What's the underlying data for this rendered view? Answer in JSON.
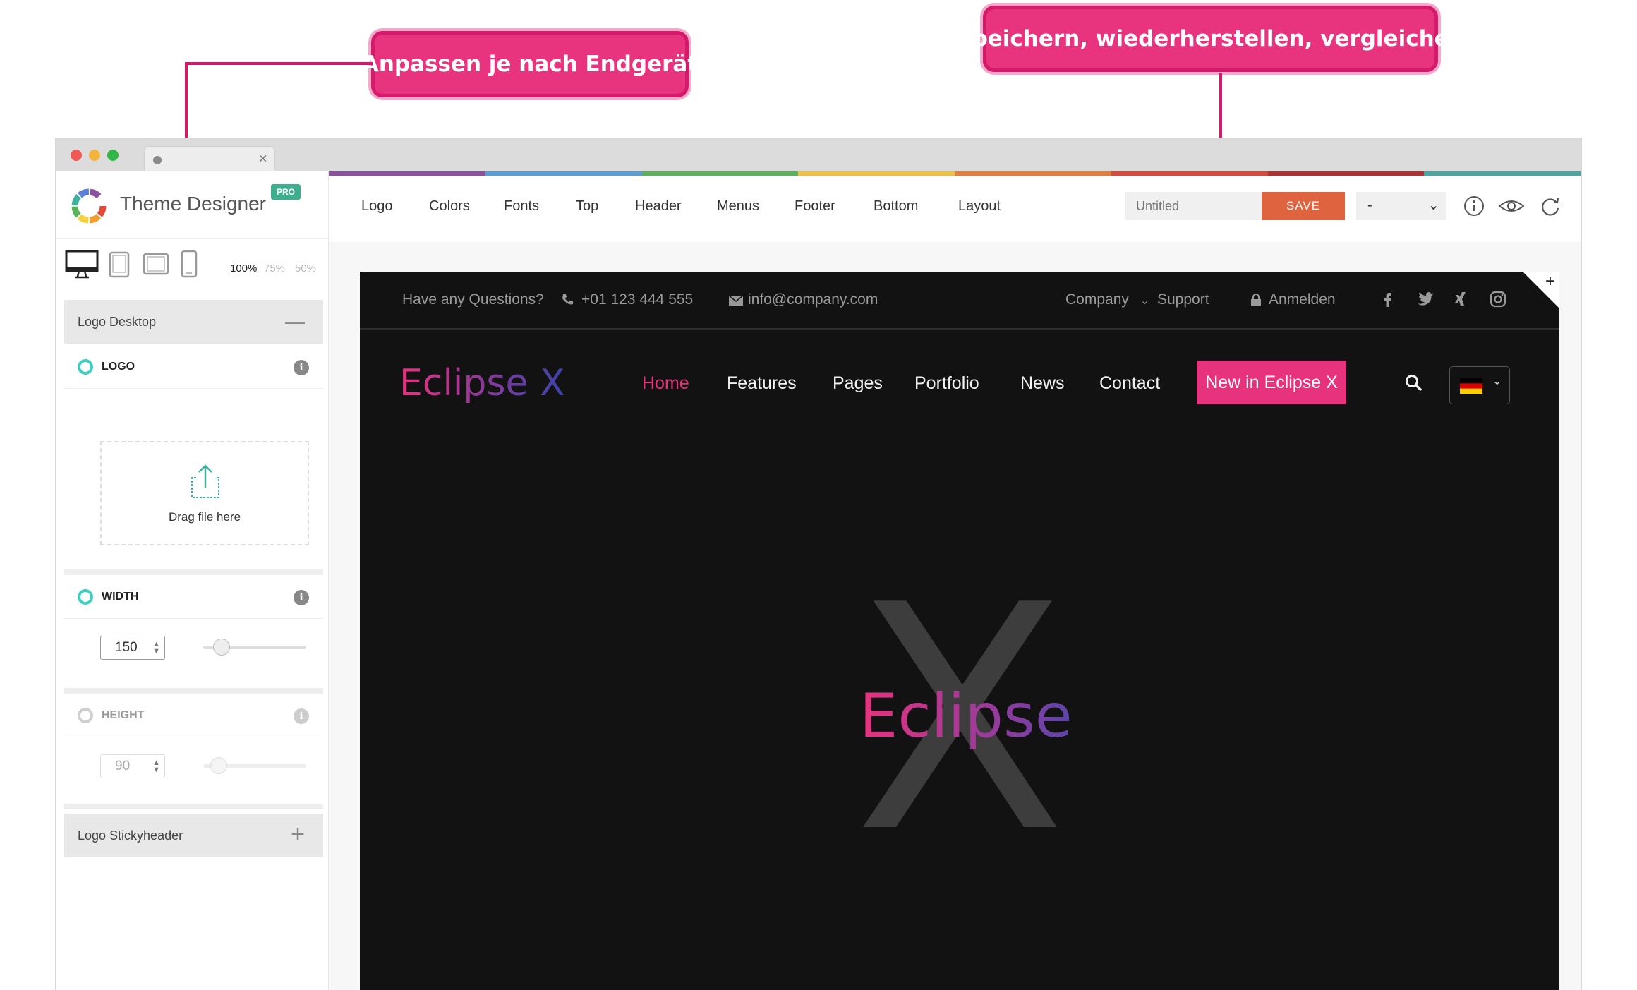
{
  "callouts": {
    "device": "Anpassen je nach Endgerät",
    "save": "Speichern, wiederherstellen, vergleichen"
  },
  "colors": {
    "accent_pink": "#e8337f",
    "save_orange": "#e0633f",
    "pro_green": "#3fae8f",
    "option_teal": "#3fcfc0",
    "strip": [
      "#8b4fa0",
      "#5a9ed8",
      "#5ab35a",
      "#f0c040",
      "#e57d3b",
      "#d9473a",
      "#b2302f",
      "#4aa6a0"
    ]
  },
  "sidebar": {
    "app_title": "Theme Designer",
    "pro_badge": "PRO",
    "devices": [
      "desktop-icon",
      "tablet-icon",
      "tablet-landscape-icon",
      "phone-icon"
    ],
    "zoom": {
      "z100": "100%",
      "z75": "75%",
      "z50": "50%"
    },
    "logo_desktop": "Logo Desktop",
    "logo_label": "LOGO",
    "drag_text": "Drag file here",
    "width_label": "WIDTH",
    "width_value": "150",
    "width_level": 0.18,
    "height_label": "HEIGHT",
    "height_value": "90",
    "height_level": 0.15,
    "logo_sticky": "Logo Stickyheader"
  },
  "topnav": {
    "items": [
      "Logo",
      "Colors",
      "Fonts",
      "Top",
      "Header",
      "Menus",
      "Footer",
      "Bottom",
      "Layout"
    ],
    "name_placeholder": "Untitled",
    "save_label": "SAVE",
    "version_value": "-"
  },
  "preview": {
    "question": "Have any Questions?",
    "phone": "+01 123 444 555",
    "email": "info@company.com",
    "company": "Company",
    "support": "Support",
    "login": "Anmelden",
    "brand": "Eclipse X",
    "menu": [
      "Home",
      "Features",
      "Pages",
      "Portfolio",
      "News",
      "Contact"
    ],
    "cta": "New in Eclipse X",
    "hero_letter": "X",
    "hero_word": "Eclipse"
  }
}
